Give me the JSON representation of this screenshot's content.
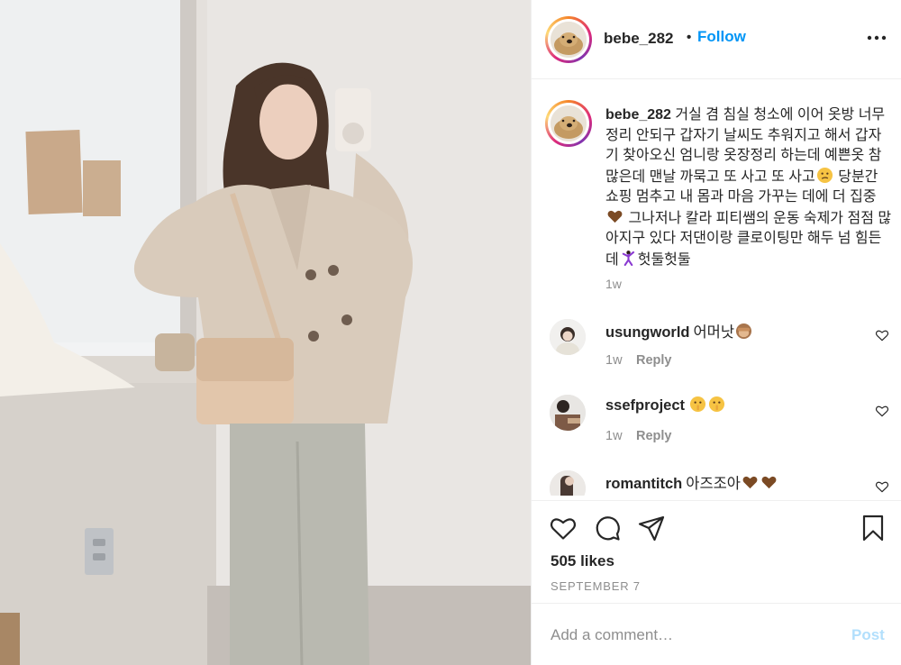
{
  "post": {
    "username": "bebe_282",
    "separator": "•",
    "follow_label": "Follow",
    "more_icon": "more-horizontal-icon"
  },
  "caption": {
    "username": "bebe_282",
    "text_1": "거실 겸 침실 청소에 이어 옷방 너무 정리 안되구 갑자기 날씨도 추워지고 해서 갑자기 찾아오신 엄니랑 옷장정리 하는데 예쁜옷 참 많은데 맨날 까묵고 또 사고 또 사고",
    "text_2": "당분간 쇼핑 멈추고 내 몸과 마음 가꾸는 데에 더 집중",
    "text_3": " 그나저나 칼라 피티쌤의 운동 숙제가 점점 많아지구 있다 저댄이랑 클로이팅만 해두 넘 힘든데",
    "text_4": "헛둘헛둘",
    "time": "1w"
  },
  "comments": [
    {
      "username": "usungworld",
      "text": "어머낫",
      "time": "1w",
      "reply_label": "Reply"
    },
    {
      "username": "ssefproject",
      "text": "",
      "time": "1w",
      "reply_label": "Reply"
    },
    {
      "username": "romantitch",
      "text": "아즈조아",
      "time": "",
      "reply_label": ""
    }
  ],
  "actions": {
    "icons": [
      "heart-icon",
      "comment-icon",
      "share-icon",
      "bookmark-icon"
    ],
    "likes": "505 likes",
    "date": "SEPTEMBER 7"
  },
  "add_comment": {
    "placeholder": "Add a comment…",
    "post_label": "Post"
  },
  "colors": {
    "link_blue": "#0095f6",
    "post_disabled": "#b2dffc",
    "muted_text": "#8e8e8e"
  }
}
